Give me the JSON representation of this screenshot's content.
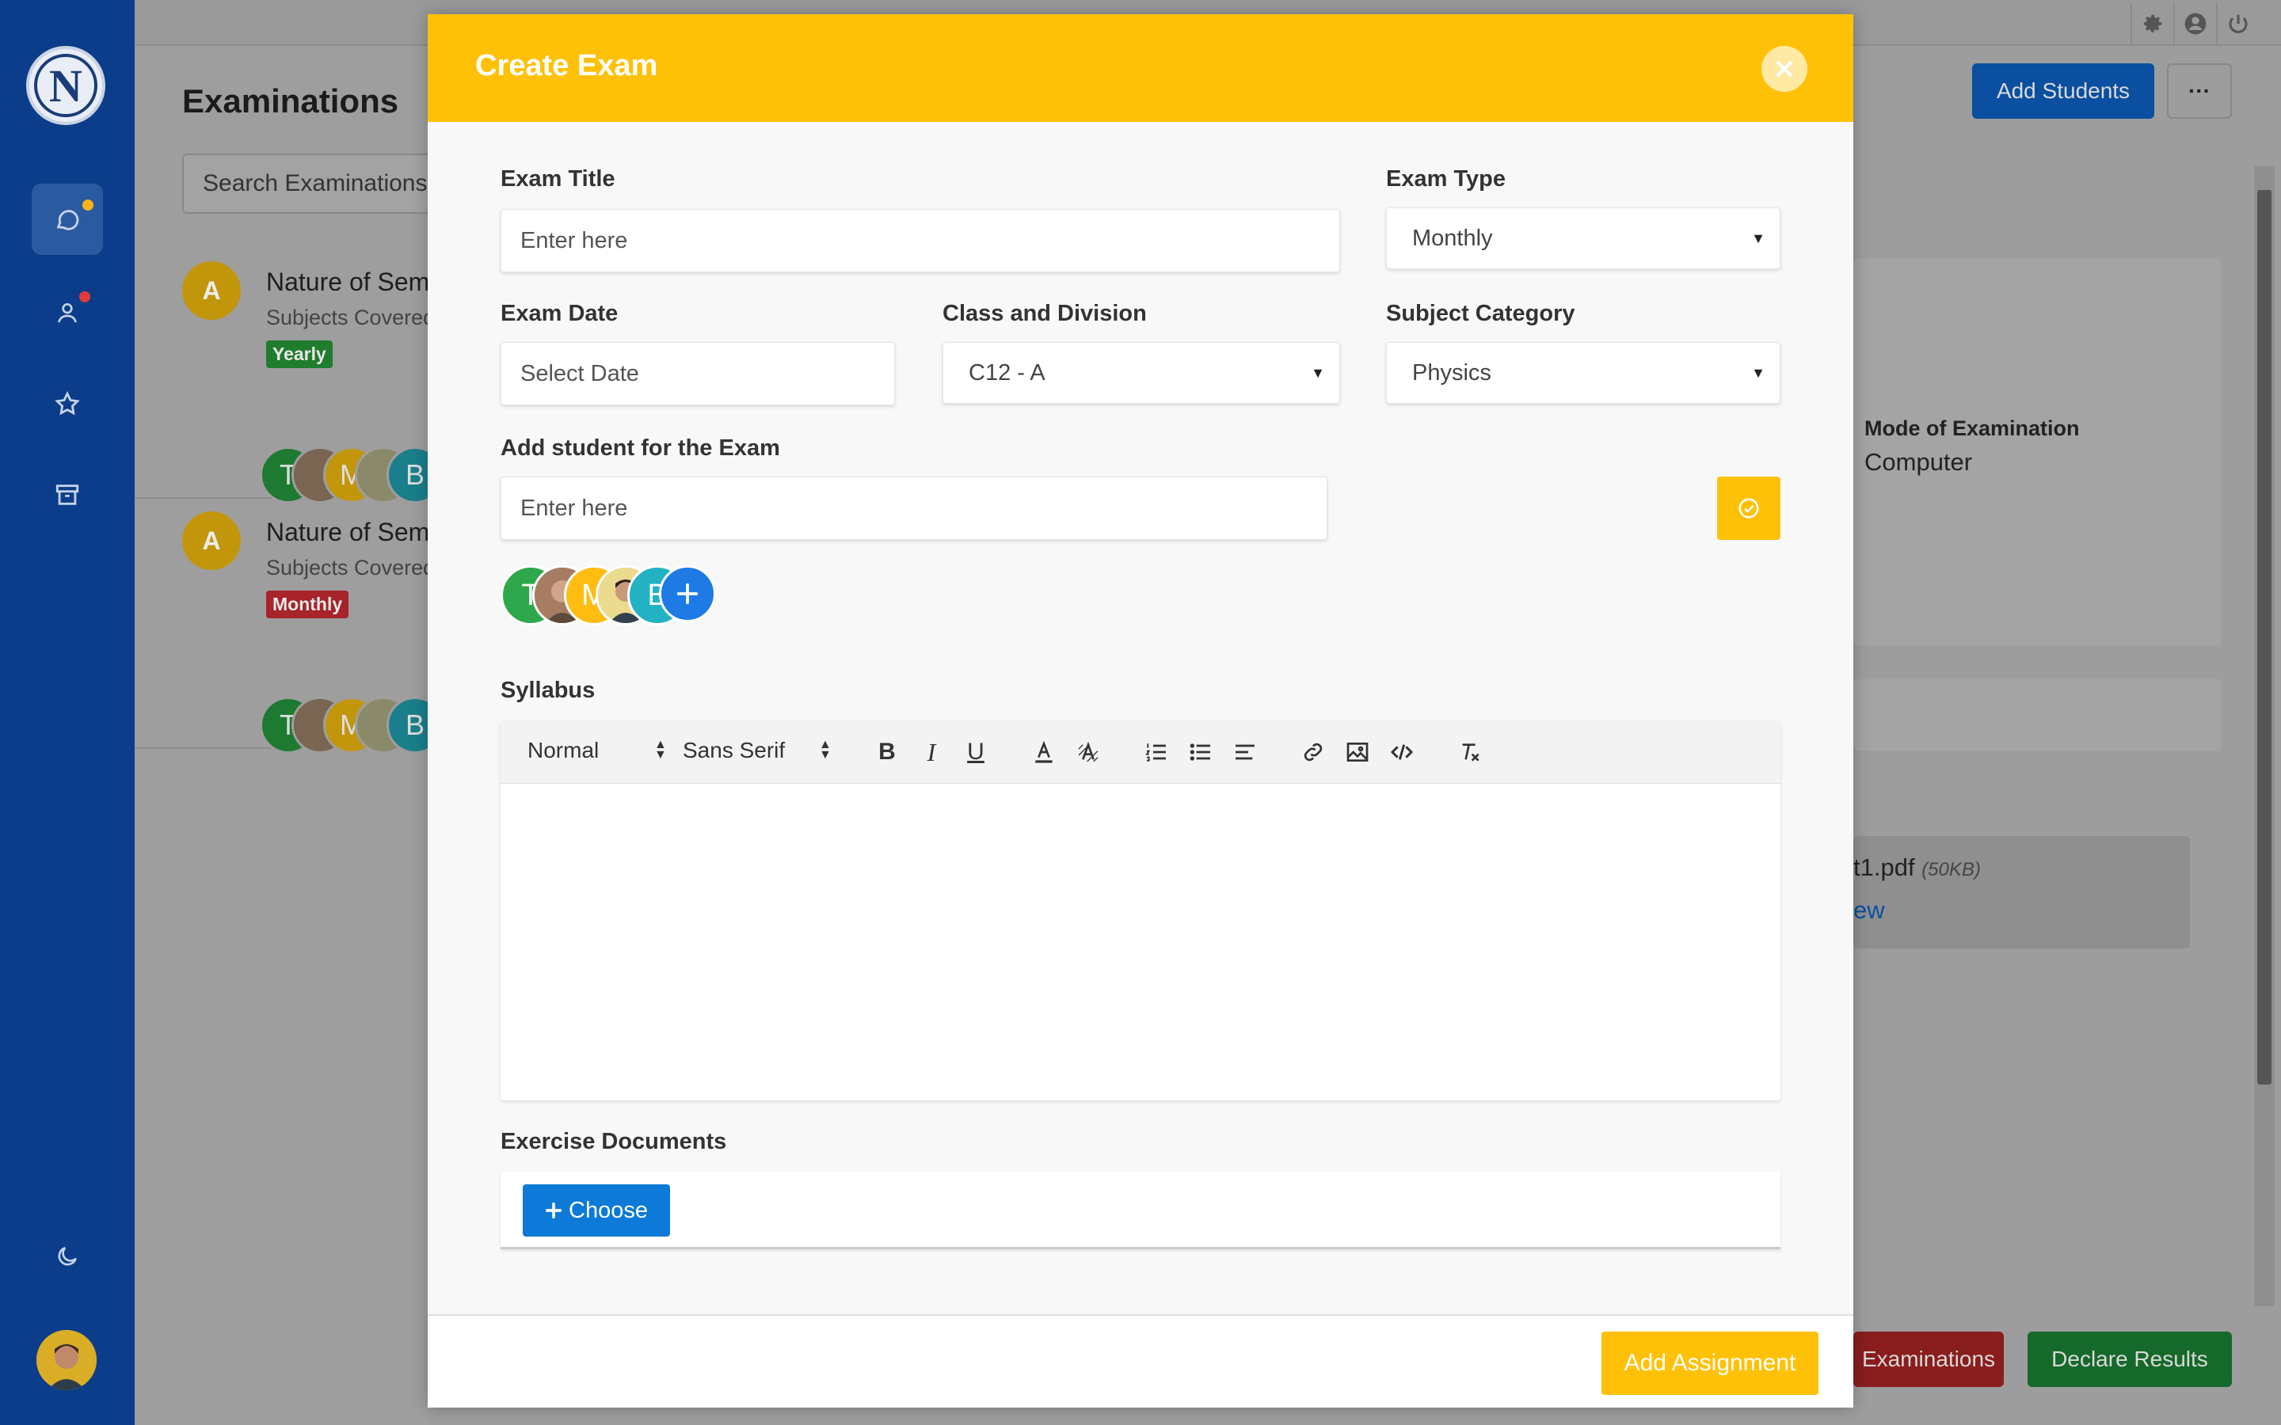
{
  "app": {
    "logo_letter": "N",
    "page_title": "Examinations",
    "search_placeholder": "Search Examinations"
  },
  "sidebar": {
    "items": [
      {
        "icon": "chat-icon",
        "active": true
      },
      {
        "icon": "user-icon"
      },
      {
        "icon": "star-icon"
      },
      {
        "icon": "archive-icon"
      }
    ],
    "bottom_icon": "moon-icon"
  },
  "topbar": {
    "icons": [
      "gear-icon",
      "account-icon",
      "power-icon"
    ]
  },
  "exam_list": [
    {
      "avatar_letter": "A",
      "title": "Nature of Semiconductors",
      "subtitle": "Subjects Covered",
      "badge": "Yearly",
      "badge_color": "#1f7d2d",
      "students": [
        "T",
        "",
        "M",
        "",
        "B"
      ]
    },
    {
      "avatar_letter": "A",
      "title": "Nature of Semiconductors",
      "subtitle": "Subjects Covered",
      "badge": "Monthly",
      "badge_color": "#a6242a",
      "students": [
        "T",
        "",
        "M",
        "",
        "B"
      ]
    }
  ],
  "background": {
    "add_students_label": "Add Students",
    "more_label": "···",
    "mode_label": "Mode of Examination",
    "mode_value": "Computer",
    "file_name": "t1.pdf",
    "file_size": "(50KB)",
    "file_action": "ew",
    "examinations_label": "Examinations",
    "declare_results_label": "Declare Results"
  },
  "modal": {
    "title": "Create Exam",
    "fields": {
      "exam_title": {
        "label": "Exam Title",
        "placeholder": "Enter here"
      },
      "exam_type": {
        "label": "Exam Type",
        "value": "Monthly"
      },
      "exam_date": {
        "label": "Exam Date",
        "placeholder": "Select Date"
      },
      "class_division": {
        "label": "Class and Division",
        "value": "C12 - A"
      },
      "subject_category": {
        "label": "Subject Category",
        "value": "Physics"
      },
      "add_student": {
        "label": "Add student for the Exam",
        "placeholder": "Enter here"
      }
    },
    "students": [
      "T",
      "",
      "M",
      "",
      "B"
    ],
    "syllabus": {
      "label": "Syllabus",
      "toolbar": {
        "heading": "Normal",
        "font": "Sans Serif"
      }
    },
    "documents": {
      "label": "Exercise Documents",
      "choose_label": "Choose"
    },
    "submit_label": "Add Assignment"
  },
  "colors": {
    "accent": "#ffc107",
    "sidebar": "#0b3d8a",
    "primary": "#0c7ad6"
  }
}
